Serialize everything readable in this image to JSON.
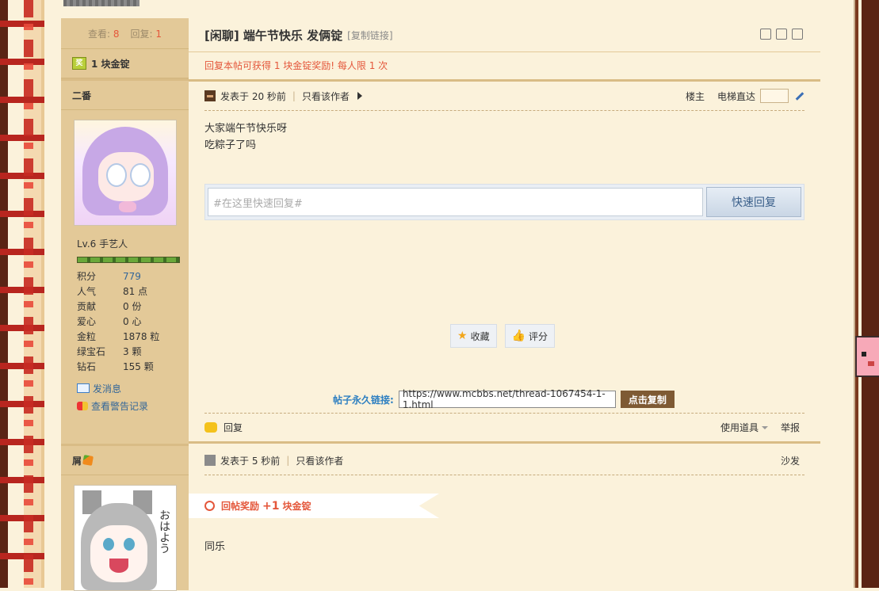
{
  "thread": {
    "views_label": "查看:",
    "views": "8",
    "replies_label": "回复:",
    "replies": "1",
    "reward_summary": "1 块金锭",
    "reward_badge": "奖",
    "title": "[闲聊] 端午节快乐 发俩锭",
    "copy_link": "[复制链接]",
    "reward_notice": "回复本帖可获得 1 块金锭奖励! 每人限 1 次"
  },
  "post1": {
    "username": "二番",
    "level": "Lv.6 手艺人",
    "stats": [
      {
        "k": "积分",
        "v": "779"
      },
      {
        "k": "人气",
        "v": "81 点"
      },
      {
        "k": "贡献",
        "v": "0 份"
      },
      {
        "k": "爱心",
        "v": "0 心"
      },
      {
        "k": "金粒",
        "v": "1878 粒"
      },
      {
        "k": "绿宝石",
        "v": "3 颗"
      },
      {
        "k": "钻石",
        "v": "155 颗"
      }
    ],
    "send_message": "发消息",
    "view_warnings": "查看警告记录",
    "posted": "发表于 20 秒前",
    "only_author": "只看该作者",
    "floor": "楼主",
    "jump_label": "电梯直达",
    "body_line1": "大家端午节快乐呀",
    "body_line2": "吃粽子了吗",
    "quick_reply_placeholder": "#在这里快速回复#",
    "quick_reply_button": "快速回复",
    "favorite": "收藏",
    "rate": "评分",
    "permalink_label": "帖子永久链接:",
    "permalink_url": "https://www.mcbbs.net/thread-1067454-1-1.html",
    "copy_button": "点击复制",
    "reply": "回复",
    "use_tool": "使用道具",
    "report": "举报"
  },
  "post2": {
    "username": "屑",
    "posted": "发表于 5 秒前",
    "only_author": "只看该作者",
    "floor": "沙发",
    "reward_prefix": "回帖奖励",
    "reward_amount": "+1",
    "reward_unit": "块金锭",
    "avatar_text": "おはよう",
    "body": "同乐"
  },
  "colors": {
    "accent_red": "#e4573b",
    "link_blue": "#336699",
    "sidebar_bg": "#e3c998",
    "page_bg": "#fbf2db"
  }
}
